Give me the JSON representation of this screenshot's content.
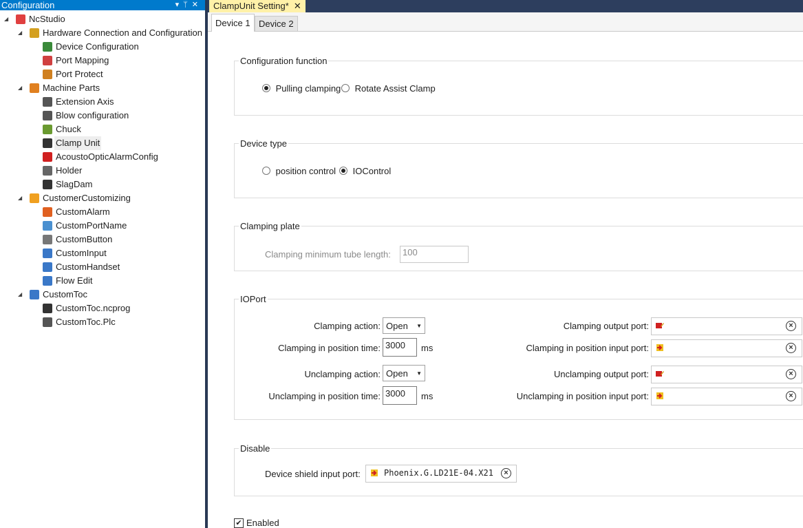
{
  "left_panel": {
    "title": "Configuration",
    "tree": [
      {
        "label": "NcStudio",
        "level": 0,
        "expanded": true,
        "icon": "ncstudio-icon",
        "color": "#e04040"
      },
      {
        "label": "Hardware Connection and Configuration",
        "level": 1,
        "expanded": true,
        "icon": "hardware-icon",
        "color": "#d4a020"
      },
      {
        "label": "Device Configuration",
        "level": 2,
        "icon": "device-config-icon",
        "color": "#3a8a3a"
      },
      {
        "label": "Port Mapping",
        "level": 2,
        "icon": "port-mapping-icon",
        "color": "#d04040"
      },
      {
        "label": "Port Protect",
        "level": 2,
        "icon": "port-protect-icon",
        "color": "#d08020"
      },
      {
        "label": "Machine Parts",
        "level": 1,
        "expanded": true,
        "icon": "machine-parts-icon",
        "color": "#e08020"
      },
      {
        "label": "Extension Axis",
        "level": 2,
        "icon": "extension-axis-icon",
        "color": "#555555"
      },
      {
        "label": "Blow configuration",
        "level": 2,
        "icon": "blow-icon",
        "color": "#555555"
      },
      {
        "label": "Chuck",
        "level": 2,
        "icon": "chuck-icon",
        "color": "#6a9a30"
      },
      {
        "label": "Clamp Unit",
        "level": 2,
        "icon": "clamp-unit-icon",
        "color": "#333333",
        "selected": true
      },
      {
        "label": "AcoustoOpticAlarmConfig",
        "level": 2,
        "icon": "alarm-light-icon",
        "color": "#d02020"
      },
      {
        "label": "Holder",
        "level": 2,
        "icon": "holder-icon",
        "color": "#666666"
      },
      {
        "label": "SlagDam",
        "level": 2,
        "icon": "slagdam-icon",
        "color": "#333333"
      },
      {
        "label": "CustomerCustomizing",
        "level": 1,
        "expanded": true,
        "icon": "customizing-icon",
        "color": "#f0a020"
      },
      {
        "label": "CustomAlarm",
        "level": 2,
        "icon": "warning-icon",
        "color": "#e06020"
      },
      {
        "label": "CustomPortName",
        "level": 2,
        "icon": "port-name-icon",
        "color": "#4a90d0"
      },
      {
        "label": "CustomButton",
        "level": 2,
        "icon": "button-icon",
        "color": "#777777"
      },
      {
        "label": "CustomInput",
        "level": 2,
        "icon": "input-icon",
        "color": "#3a78c8"
      },
      {
        "label": "CustomHandset",
        "level": 2,
        "icon": "handset-icon",
        "color": "#3a78c8"
      },
      {
        "label": "Flow Edit",
        "level": 2,
        "icon": "flow-edit-icon",
        "color": "#3a78c8"
      },
      {
        "label": "CustomToc",
        "level": 1,
        "expanded": true,
        "icon": "puzzle-icon",
        "color": "#3a78c8"
      },
      {
        "label": "CustomToc.ncprog",
        "level": 2,
        "icon": "code-file-icon",
        "color": "#333333"
      },
      {
        "label": "CustomToc.Plc",
        "level": 2,
        "icon": "plc-file-icon",
        "color": "#555555"
      }
    ]
  },
  "doc_tab": {
    "label": "ClampUnit Setting*",
    "close": "✕"
  },
  "device_tabs": [
    {
      "label": "Device 1",
      "active": true
    },
    {
      "label": "Device 2",
      "active": false
    }
  ],
  "config_function": {
    "title": "Configuration function",
    "opt1": "Pulling clamping",
    "opt2": "Rotate Assist Clamp",
    "selected": 1
  },
  "device_type": {
    "title": "Device type",
    "opt1": "position control",
    "opt2": "IOControl",
    "selected": 2
  },
  "clamping_plate": {
    "title": "Clamping plate",
    "min_tube_label": "Clamping minimum tube length:",
    "min_tube_value": "100"
  },
  "ioport": {
    "title": "IOPort",
    "clamp_action_label": "Clamping action:",
    "clamp_action_value": "Open",
    "clamp_time_label": "Clamping in position time:",
    "clamp_time_value": "3000",
    "unclamp_action_label": "Unclamping action:",
    "unclamp_action_value": "Open",
    "unclamp_time_label": "Unclamping in position time:",
    "unclamp_time_value": "3000",
    "ms": "ms",
    "clamp_out_label": "Clamping output port:",
    "clamp_in_label": "Clamping in position input port:",
    "unclamp_out_label": "Unclamping output port:",
    "unclamp_in_label": "Unclamping in position input port:"
  },
  "disable": {
    "title": "Disable",
    "shield_label": "Device shield input port:",
    "shield_value": "Phoenix.G.LD21E-04.X21"
  },
  "enabled": {
    "label": "Enabled",
    "checked": true
  },
  "colors": {
    "accent": "#007acc",
    "tab_bar": "#2d3e5e",
    "doc_tab": "#fff1a8",
    "splitter": "#293955"
  }
}
